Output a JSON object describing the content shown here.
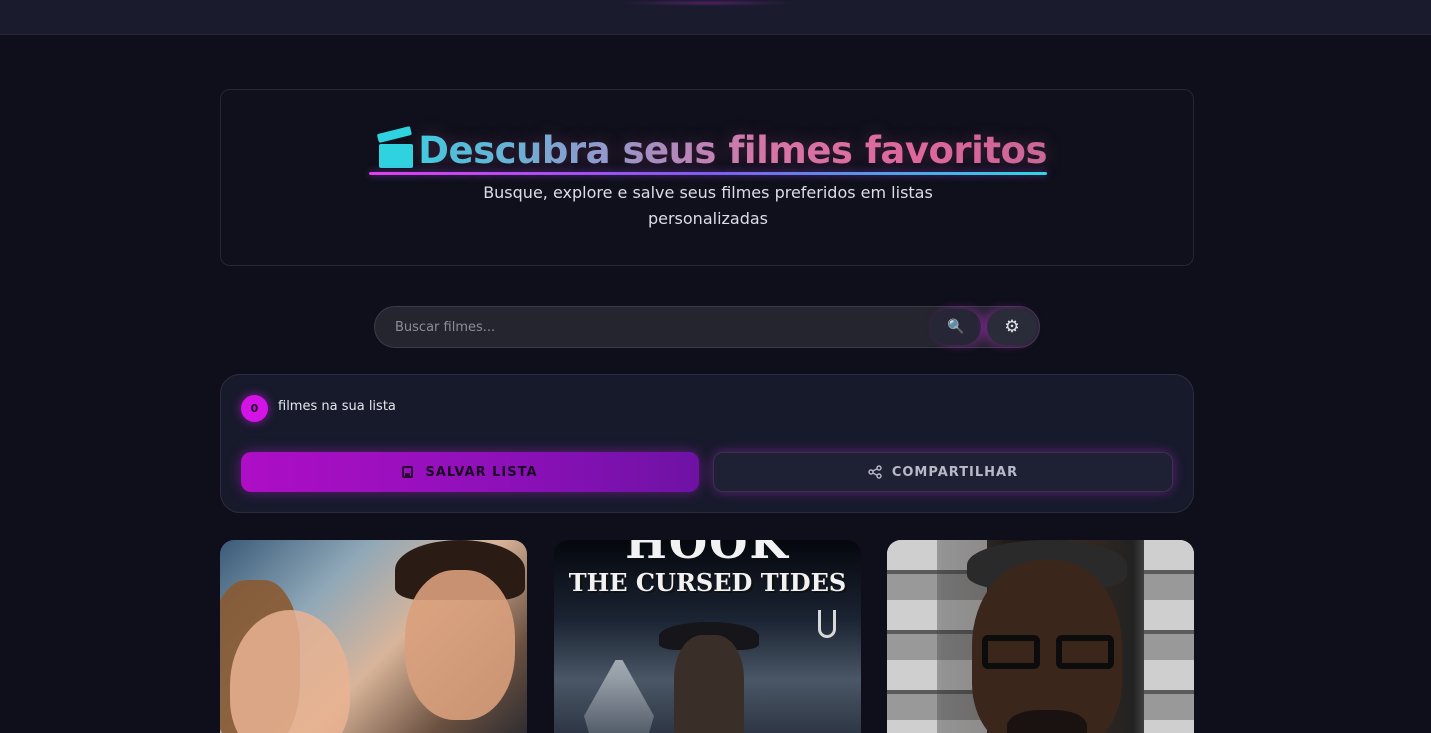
{
  "hero": {
    "title": "Descubra seus filmes favoritos",
    "subtitle": "Busque, explore e salve seus filmes preferidos em listas personalizadas"
  },
  "search": {
    "placeholder": "Buscar filmes..."
  },
  "list": {
    "count": "0",
    "count_label": "filmes na sua lista",
    "save_label": "SALVAR LISTA",
    "share_label": "COMPARTILHAR"
  },
  "posters": [
    {
      "title": ""
    },
    {
      "title_line1": "HOOK",
      "title_line2": "THE CURSED TIDES"
    },
    {
      "title": ""
    }
  ],
  "colors": {
    "accent": "#d414e6",
    "cyan": "#2fd3e0",
    "background": "#0e0f1a"
  },
  "icons": {
    "hero": "clapperboard-icon",
    "search": "magnifier-icon",
    "settings": "gear-icon",
    "save": "floppy-disk-icon",
    "share": "share-icon"
  }
}
